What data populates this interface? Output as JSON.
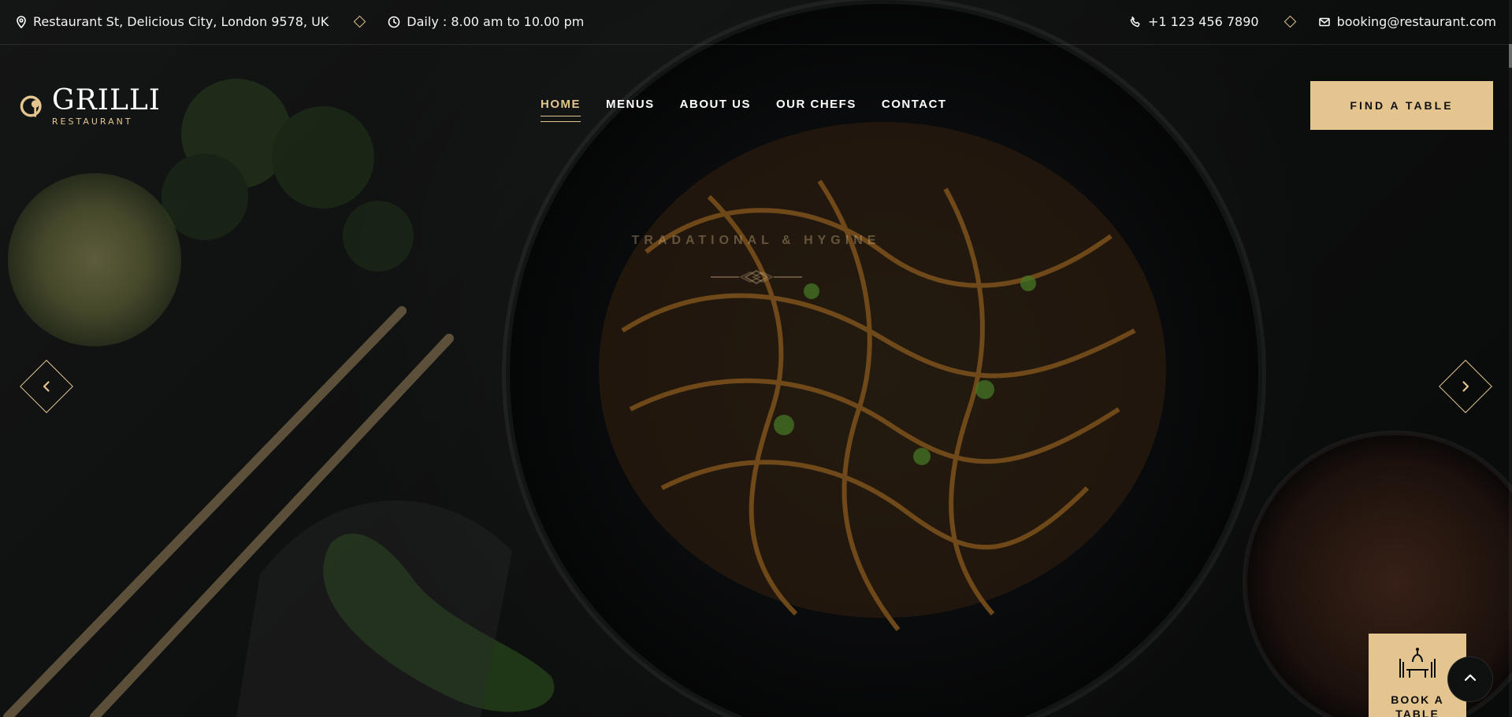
{
  "topbar": {
    "address": "Restaurant St, Delicious City, London 9578, UK",
    "hours": "Daily : 8.00 am to 10.00 pm",
    "phone": "+1 123 456 7890",
    "email": "booking@restaurant.com"
  },
  "brand": {
    "name": "GRILLI",
    "tagline": "RESTAURANT"
  },
  "nav": {
    "items": [
      {
        "label": "HOME"
      },
      {
        "label": "MENUS"
      },
      {
        "label": "ABOUT US"
      },
      {
        "label": "OUR CHEFS"
      },
      {
        "label": "CONTACT"
      }
    ]
  },
  "header": {
    "cta": "FIND A TABLE"
  },
  "hero": {
    "subtitle": "TRADATIONAL & HYGINE"
  },
  "widgets": {
    "book_label": "BOOK A TABLE"
  },
  "icons": {
    "address": "location-pin-icon",
    "hours": "clock-icon",
    "phone": "phone-icon",
    "email": "mail-icon",
    "prev": "chevron-left-icon",
    "next": "chevron-right-icon",
    "scroll_top": "chevron-up-icon",
    "book": "table-dining-icon"
  },
  "colors": {
    "accent": "#e4c590",
    "text": "#f3f3f3",
    "bg": "#0b0c0c"
  }
}
